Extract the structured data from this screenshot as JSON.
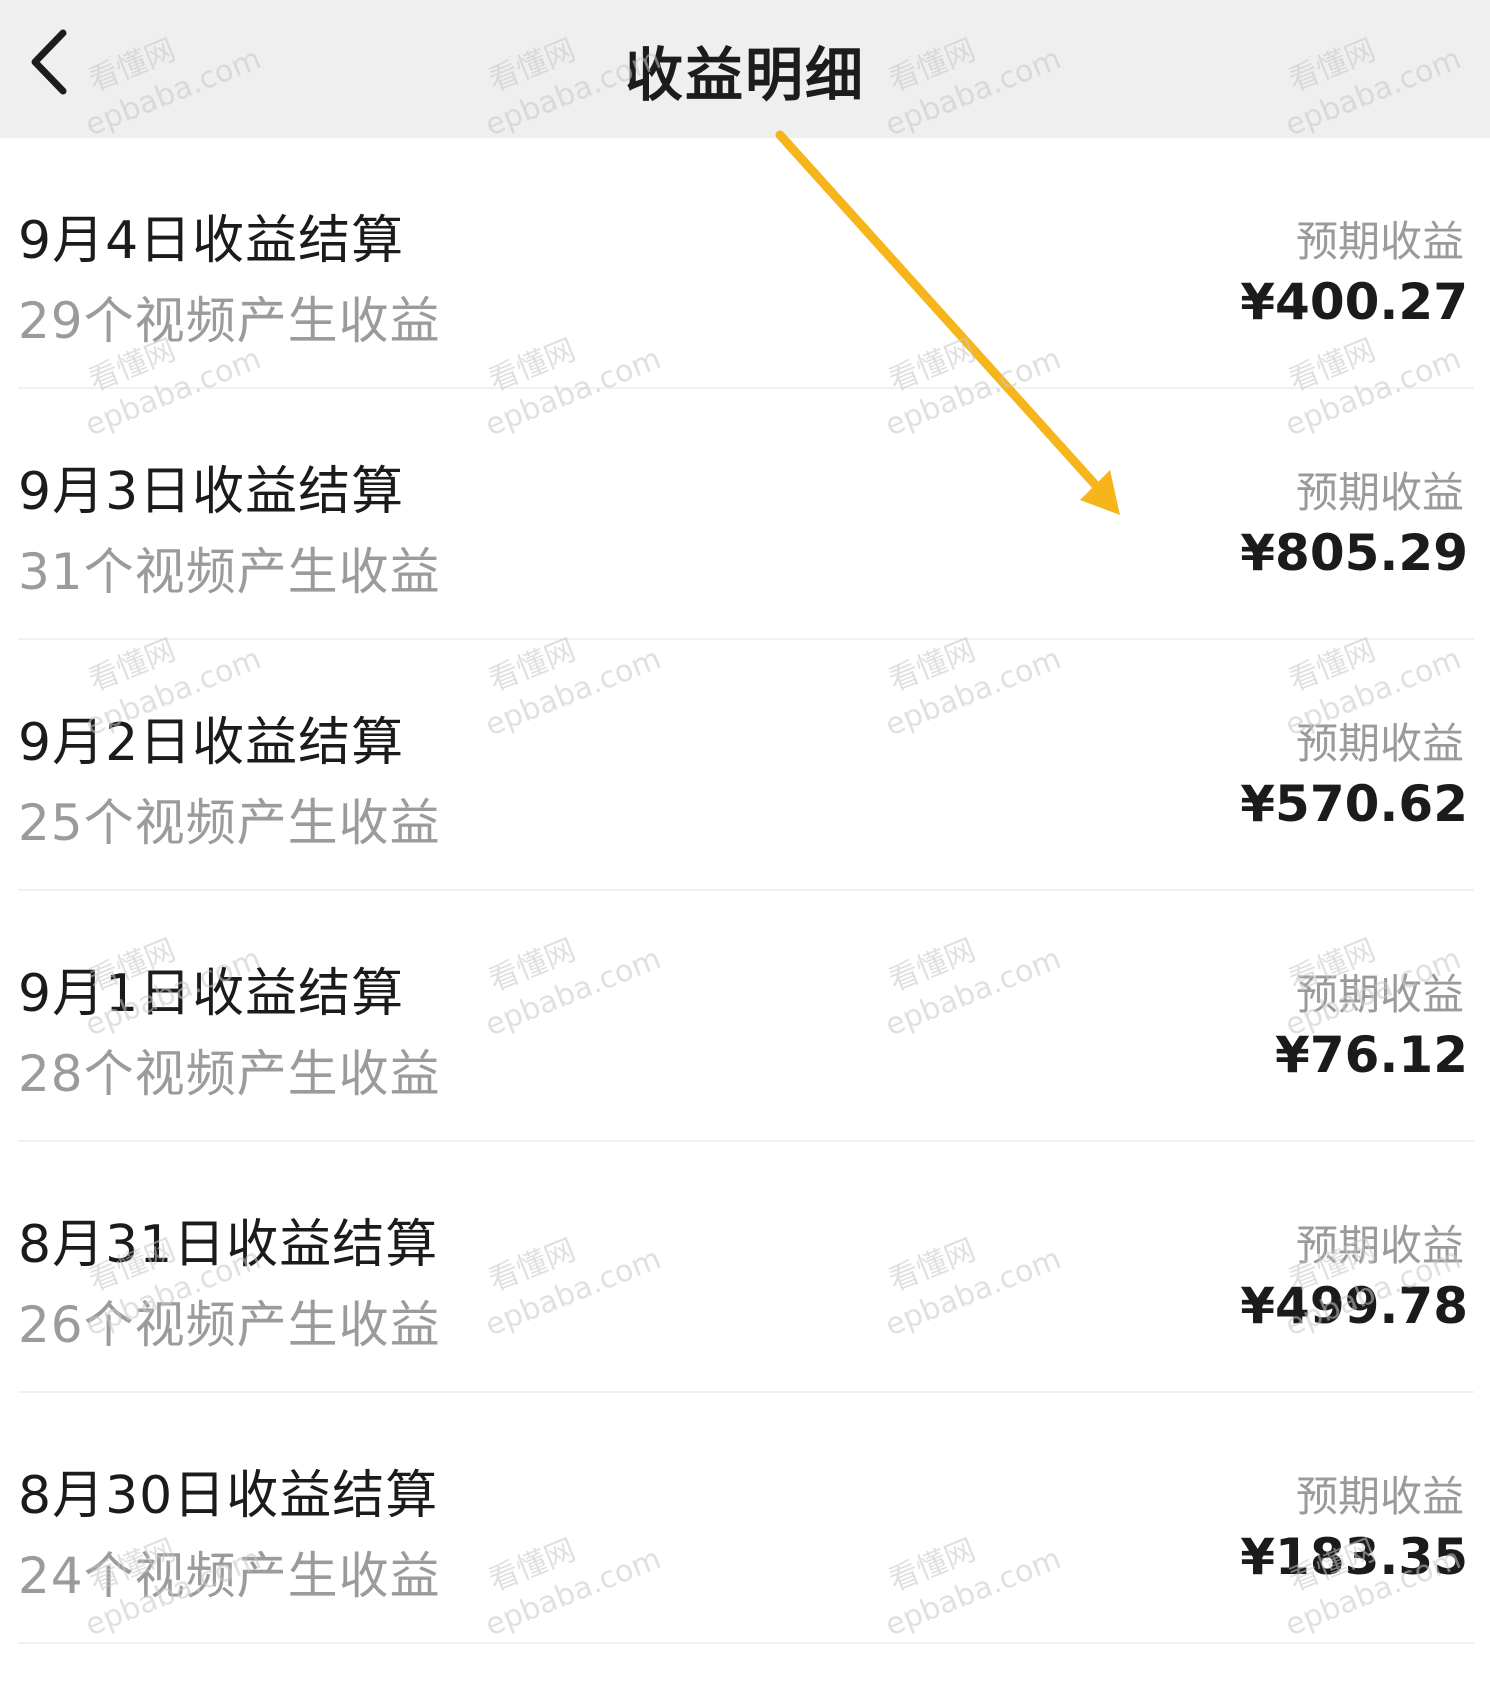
{
  "header": {
    "title": "收益明细",
    "back_icon": "chevron-left-icon"
  },
  "rows": [
    {
      "title": "9月4日收益结算",
      "subtitle": "29个视频产生收益",
      "label": "预期收益",
      "amount": "¥400.27"
    },
    {
      "title": "9月3日收益结算",
      "subtitle": "31个视频产生收益",
      "label": "预期收益",
      "amount": "¥805.29"
    },
    {
      "title": "9月2日收益结算",
      "subtitle": "25个视频产生收益",
      "label": "预期收益",
      "amount": "¥570.62"
    },
    {
      "title": "9月1日收益结算",
      "subtitle": "28个视频产生收益",
      "label": "预期收益",
      "amount": "¥76.12"
    },
    {
      "title": "8月31日收益结算",
      "subtitle": "26个视频产生收益",
      "label": "预期收益",
      "amount": "¥499.78"
    },
    {
      "title": "8月30日收益结算",
      "subtitle": "24个视频产生收益",
      "label": "预期收益",
      "amount": "¥183.35"
    }
  ],
  "watermark": {
    "line1": "看懂网",
    "line2": "epbaba.com"
  },
  "colors": {
    "header_bg": "#efefef",
    "arrow": "#f5b51b",
    "title_text": "#1b1b1b",
    "muted_text": "#9b9b9b"
  }
}
